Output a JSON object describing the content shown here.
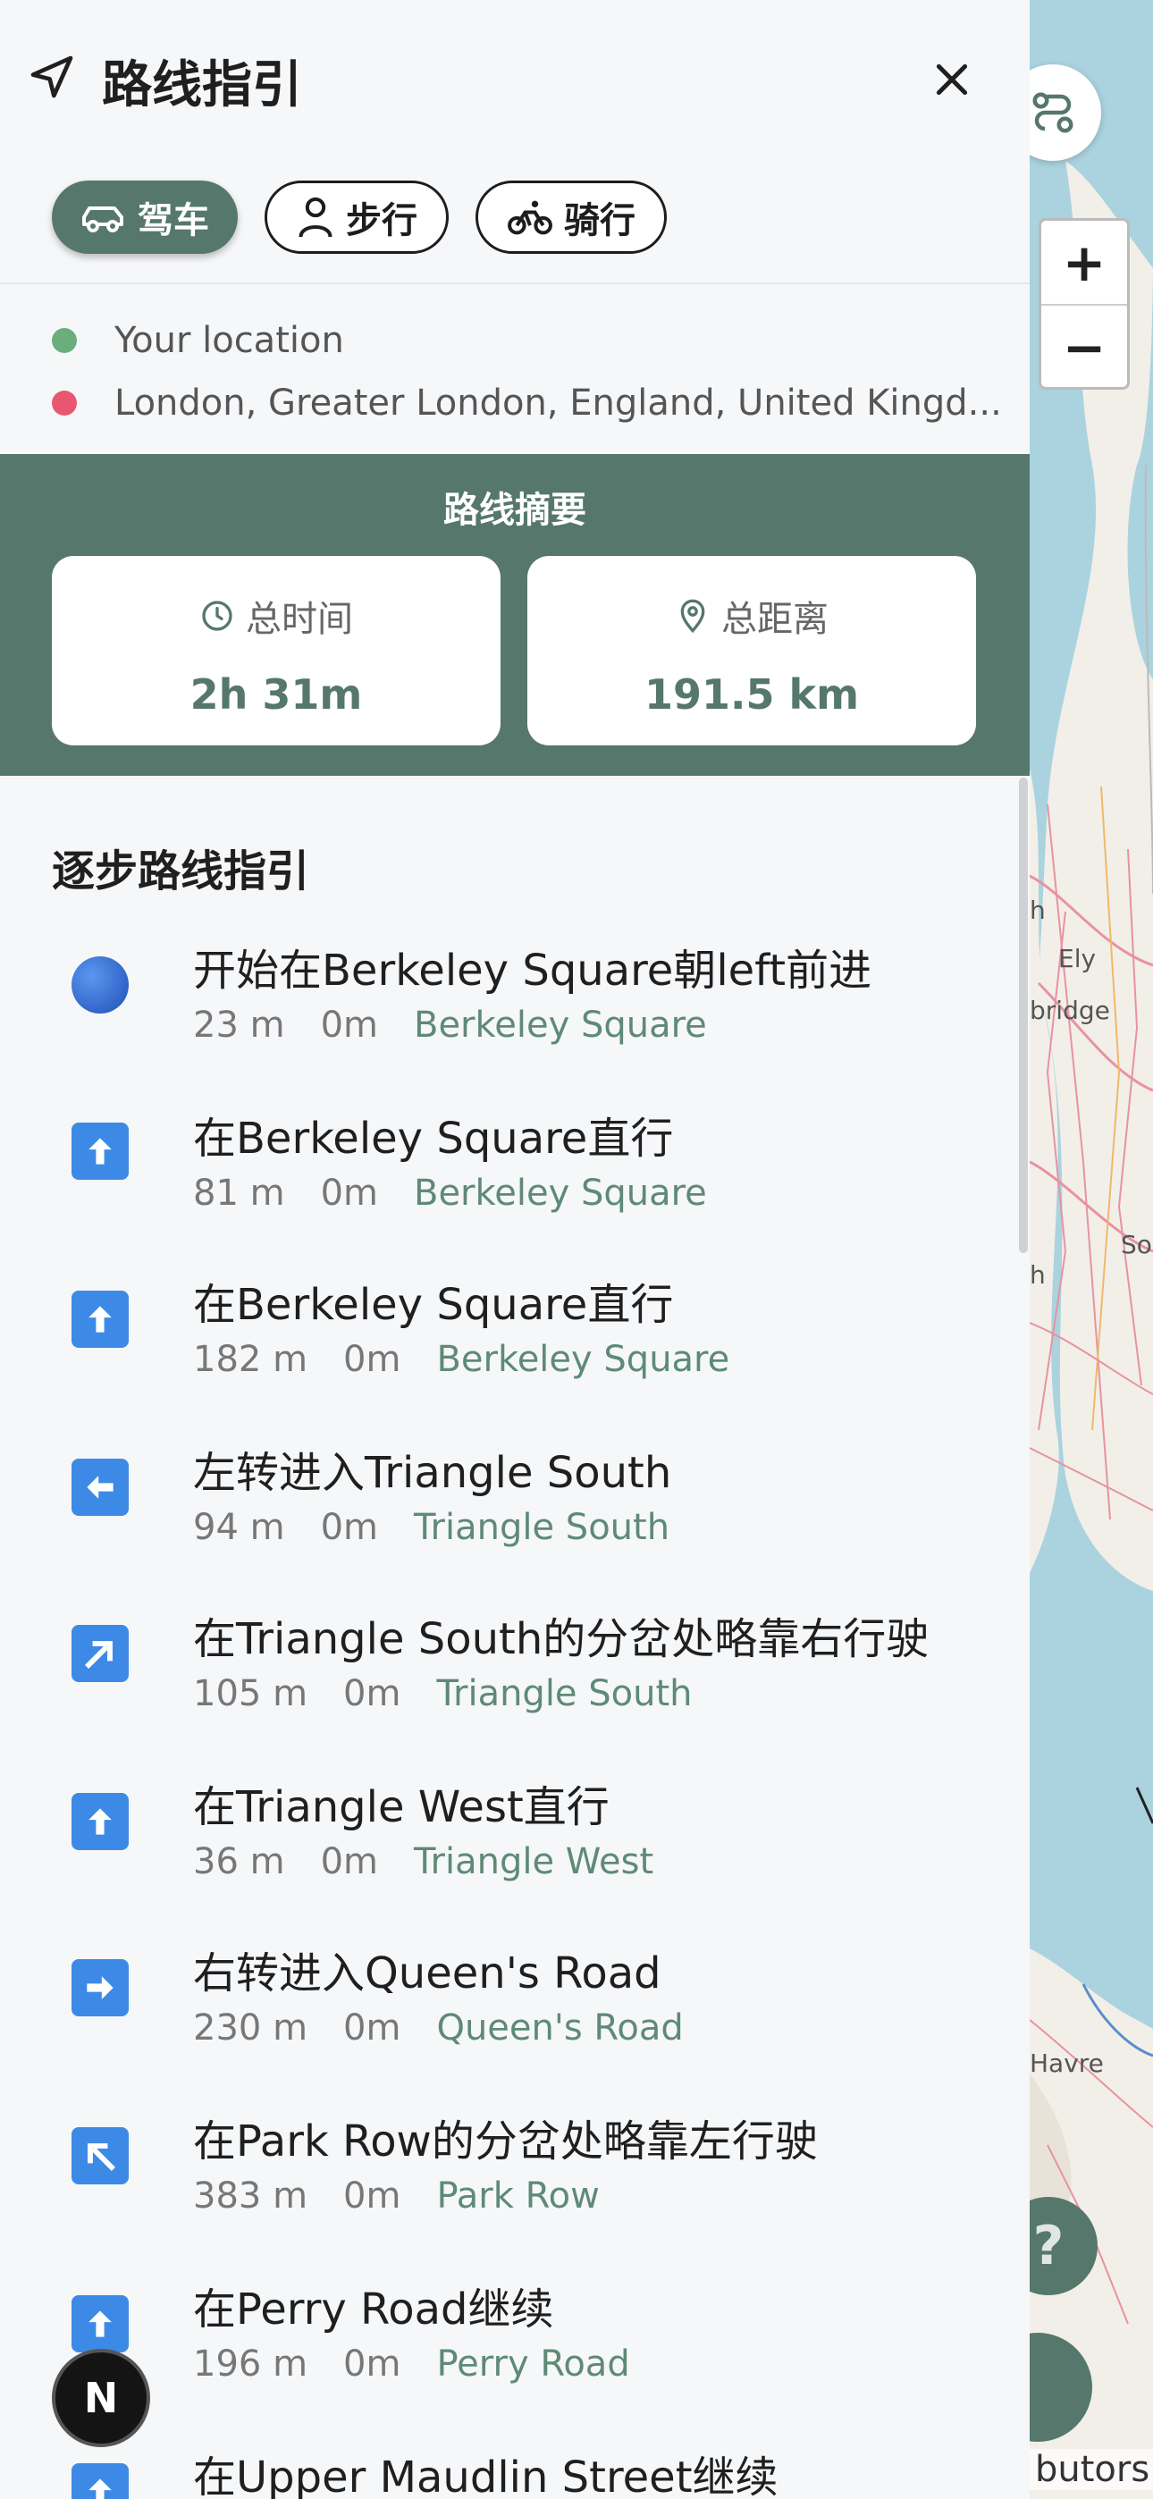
{
  "header": {
    "title": "路线指引"
  },
  "modes": [
    {
      "label": "驾车",
      "icon": "car-icon",
      "active": true
    },
    {
      "label": "步行",
      "icon": "person-icon",
      "active": false
    },
    {
      "label": "骑行",
      "icon": "bike-icon",
      "active": false
    }
  ],
  "locations": {
    "origin": "Your location",
    "destination": "London, Greater London, England, United Kingd...",
    "origin_color": "#6aae7c",
    "destination_color": "#e8576f"
  },
  "summary": {
    "title": "路线摘要",
    "time_label": "总时间",
    "time_value": "2h 31m",
    "distance_label": "总距离",
    "distance_value": "191.5 km"
  },
  "steps_title": "逐步路线指引",
  "steps": [
    {
      "text": "开始在Berkeley Square朝left前进",
      "distance": "23 m",
      "time": "0m",
      "road": "Berkeley Square",
      "icon": "start-dot-icon"
    },
    {
      "text": "在Berkeley Square直行",
      "distance": "81 m",
      "time": "0m",
      "road": "Berkeley Square",
      "icon": "arrow-up-icon"
    },
    {
      "text": "在Berkeley Square直行",
      "distance": "182 m",
      "time": "0m",
      "road": "Berkeley Square",
      "icon": "arrow-up-icon"
    },
    {
      "text": "左转进入Triangle South",
      "distance": "94 m",
      "time": "0m",
      "road": "Triangle South",
      "icon": "arrow-left-icon"
    },
    {
      "text": "在Triangle South的分岔处略靠右行驶",
      "distance": "105 m",
      "time": "0m",
      "road": "Triangle South",
      "icon": "arrow-up-right-icon"
    },
    {
      "text": "在Triangle West直行",
      "distance": "36 m",
      "time": "0m",
      "road": "Triangle West",
      "icon": "arrow-up-icon"
    },
    {
      "text": "右转进入Queen's Road",
      "distance": "230 m",
      "time": "0m",
      "road": "Queen's Road",
      "icon": "arrow-right-icon"
    },
    {
      "text": "在Park Row的分岔处略靠左行驶",
      "distance": "383 m",
      "time": "0m",
      "road": "Park Row",
      "icon": "arrow-up-left-icon"
    },
    {
      "text": "在Perry Road继续",
      "distance": "196 m",
      "time": "0m",
      "road": "Perry Road",
      "icon": "arrow-up-icon"
    },
    {
      "text": "在Upper Maudlin Street继续",
      "distance": "",
      "time": "",
      "road": "",
      "icon": "arrow-up-icon"
    }
  ],
  "map": {
    "labels": [
      "h",
      "Ely",
      "bridge",
      "h",
      "So",
      "Havre",
      "butors"
    ],
    "zoom_in": "+",
    "zoom_out": "−",
    "help": "?"
  },
  "nav_badge": "N",
  "colors": {
    "accent": "#56776c",
    "step_icon": "#3d8ae6"
  }
}
